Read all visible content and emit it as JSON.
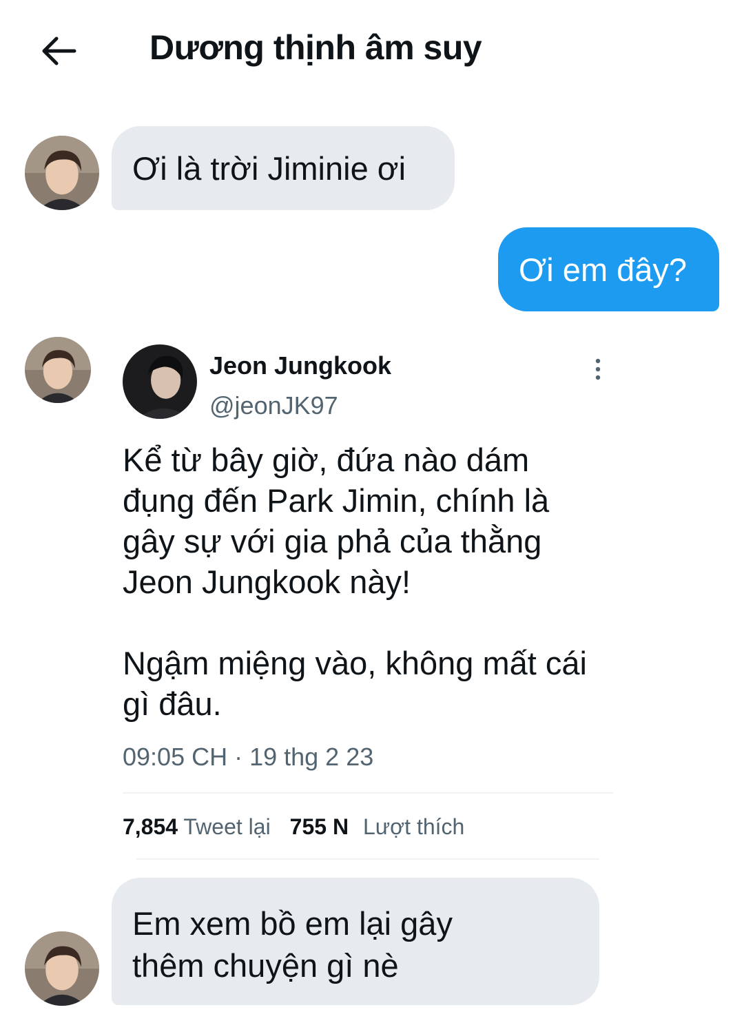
{
  "header": {
    "back_icon": "arrow-left-icon",
    "title": "Dương thịnh âm suy"
  },
  "messages": [
    {
      "direction": "incoming",
      "text": "Ơi là trời Jiminie ơi"
    },
    {
      "direction": "outgoing",
      "text": "Ơi em đây?"
    },
    {
      "direction": "incoming",
      "type": "shared-tweet"
    },
    {
      "direction": "incoming",
      "lines": [
        "Em xem bồ em lại gây",
        "thêm chuyện gì nè"
      ]
    }
  ],
  "tweet": {
    "author_name": "Jeon Jungkook",
    "handle": "@jeonJK97",
    "body_lines": [
      "Kể từ bây giờ, đứa nào dám",
      "đụng đến Park Jimin, chính là",
      "gây sự với gia phả của thằng",
      "Jeon Jungkook này!",
      "",
      "Ngậm miệng vào, không mất cái",
      "gì đâu."
    ],
    "time": "09:05 CH · 19 thg 2 23",
    "retweets_count": "7,854",
    "retweets_label": "Tweet lại",
    "likes_count": "755 N",
    "likes_label": "Lượt thích",
    "more_icon": "more-vertical-icon"
  },
  "colors": {
    "accent": "#1d9bf0",
    "incoming_bubble": "#e7ebef",
    "secondary_text": "#536471"
  }
}
